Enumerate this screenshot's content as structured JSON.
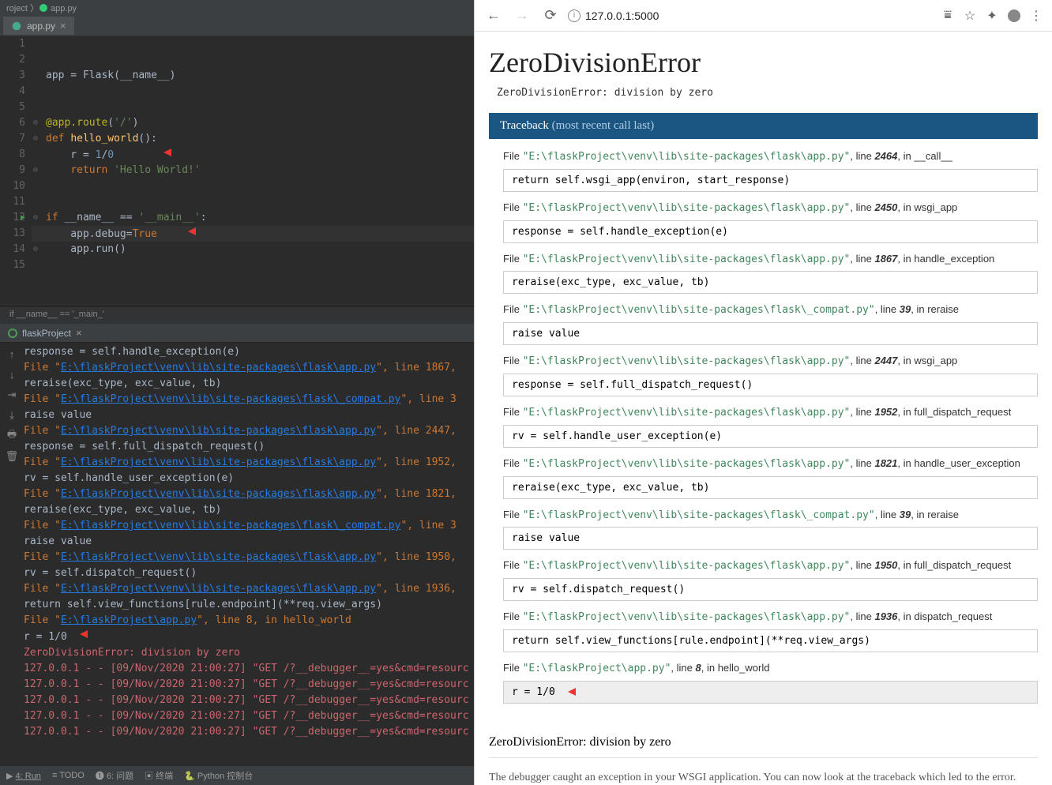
{
  "ide": {
    "project_label": "roject",
    "file_label": "app.py",
    "tab": {
      "label": "app.py"
    },
    "lines": [
      "1",
      "2",
      "3",
      "4",
      "5",
      "6",
      "7",
      "8",
      "9",
      "10",
      "11",
      "12",
      "13",
      "14",
      "15"
    ],
    "code": {
      "l3": "app = Flask(__name__)",
      "l6": "@app.route('/')",
      "l7": "def hello_world():",
      "l8": "    r = 1/0",
      "l9": "    return 'Hello World!'",
      "l12": "if __name__ == '__main__':",
      "l13": "    app.debug=True",
      "l14": "    app.run()"
    },
    "crumb": "if __name__ == '_main_'",
    "console": {
      "tab": "flaskProject",
      "lines": [
        {
          "indent": 2,
          "txt": "response = self.handle_exception(e)",
          "cls": ""
        },
        {
          "indent": 1,
          "file": "E:\\flaskProject\\venv\\lib\\site-packages\\flask\\app.py",
          "after": ", line 1867,"
        },
        {
          "indent": 2,
          "txt": "reraise(exc_type, exc_value, tb)",
          "cls": ""
        },
        {
          "indent": 1,
          "file": "E:\\flaskProject\\venv\\lib\\site-packages\\flask\\_compat.py",
          "after": ", line 3"
        },
        {
          "indent": 2,
          "txt": "raise value",
          "cls": ""
        },
        {
          "indent": 1,
          "file": "E:\\flaskProject\\venv\\lib\\site-packages\\flask\\app.py",
          "after": ", line 2447,"
        },
        {
          "indent": 2,
          "txt": "response = self.full_dispatch_request()",
          "cls": ""
        },
        {
          "indent": 1,
          "file": "E:\\flaskProject\\venv\\lib\\site-packages\\flask\\app.py",
          "after": ", line 1952,"
        },
        {
          "indent": 2,
          "txt": "rv = self.handle_user_exception(e)",
          "cls": ""
        },
        {
          "indent": 1,
          "file": "E:\\flaskProject\\venv\\lib\\site-packages\\flask\\app.py",
          "after": ", line 1821,"
        },
        {
          "indent": 2,
          "txt": "reraise(exc_type, exc_value, tb)",
          "cls": ""
        },
        {
          "indent": 1,
          "file": "E:\\flaskProject\\venv\\lib\\site-packages\\flask\\_compat.py",
          "after": ", line 3"
        },
        {
          "indent": 2,
          "txt": "raise value",
          "cls": ""
        },
        {
          "indent": 1,
          "file": "E:\\flaskProject\\venv\\lib\\site-packages\\flask\\app.py",
          "after": ", line 1950,"
        },
        {
          "indent": 2,
          "txt": "rv = self.dispatch_request()",
          "cls": ""
        },
        {
          "indent": 1,
          "file": "E:\\flaskProject\\venv\\lib\\site-packages\\flask\\app.py",
          "after": ", line 1936,"
        },
        {
          "indent": 2,
          "txt": "return self.view_functions[rule.endpoint](**req.view_args)",
          "cls": ""
        },
        {
          "indent": 1,
          "file": "E:\\flaskProject\\app.py",
          "after": ", line 8, in hello_world"
        },
        {
          "indent": 2,
          "txt": "r = 1/0",
          "cls": "",
          "arrow": true
        },
        {
          "indent": 0,
          "txt": "ZeroDivisionError: division by zero",
          "cls": "cerr"
        },
        {
          "indent": 0,
          "txt": "127.0.0.1 - - [09/Nov/2020 21:00:27] \"GET /?__debugger__=yes&cmd=resourc",
          "cls": "cerr"
        },
        {
          "indent": 0,
          "txt": "127.0.0.1 - - [09/Nov/2020 21:00:27] \"GET /?__debugger__=yes&cmd=resourc",
          "cls": "cerr"
        },
        {
          "indent": 0,
          "txt": "127.0.0.1 - - [09/Nov/2020 21:00:27] \"GET /?__debugger__=yes&cmd=resourc",
          "cls": "cerr"
        },
        {
          "indent": 0,
          "txt": "127.0.0.1 - - [09/Nov/2020 21:00:27] \"GET /?__debugger__=yes&cmd=resourc",
          "cls": "cerr"
        },
        {
          "indent": 0,
          "txt": "127.0.0.1 - - [09/Nov/2020 21:00:27] \"GET /?__debugger__=yes&cmd=resourc",
          "cls": "cerr"
        }
      ]
    },
    "status": {
      "run": "4: Run",
      "todo": "≡ TODO",
      "problems": "❶ 6: 问题",
      "terminal": "▣ 终端",
      "python": "Python 控制台"
    }
  },
  "browser": {
    "url": "127.0.0.1:5000",
    "title": "ZeroDivisionError",
    "exc_msg": "ZeroDivisionError: division by zero",
    "tb_header": "Traceback",
    "tb_sub": "(most recent call last)",
    "frames": [
      {
        "path": "E:\\flaskProject\\venv\\lib\\site-packages\\flask\\app.py",
        "line": "2464",
        "fn": "__call__",
        "code": "return self.wsgi_app(environ, start_response)"
      },
      {
        "path": "E:\\flaskProject\\venv\\lib\\site-packages\\flask\\app.py",
        "line": "2450",
        "fn": "wsgi_app",
        "code": "response = self.handle_exception(e)"
      },
      {
        "path": "E:\\flaskProject\\venv\\lib\\site-packages\\flask\\app.py",
        "line": "1867",
        "fn": "handle_exception",
        "code": "reraise(exc_type, exc_value, tb)"
      },
      {
        "path": "E:\\flaskProject\\venv\\lib\\site-packages\\flask\\_compat.py",
        "line": "39",
        "fn": "reraise",
        "code": "raise value"
      },
      {
        "path": "E:\\flaskProject\\venv\\lib\\site-packages\\flask\\app.py",
        "line": "2447",
        "fn": "wsgi_app",
        "code": "response = self.full_dispatch_request()"
      },
      {
        "path": "E:\\flaskProject\\venv\\lib\\site-packages\\flask\\app.py",
        "line": "1952",
        "fn": "full_dispatch_request",
        "code": "rv = self.handle_user_exception(e)"
      },
      {
        "path": "E:\\flaskProject\\venv\\lib\\site-packages\\flask\\app.py",
        "line": "1821",
        "fn": "handle_user_exception",
        "code": "reraise(exc_type, exc_value, tb)"
      },
      {
        "path": "E:\\flaskProject\\venv\\lib\\site-packages\\flask\\_compat.py",
        "line": "39",
        "fn": "reraise",
        "code": "raise value"
      },
      {
        "path": "E:\\flaskProject\\venv\\lib\\site-packages\\flask\\app.py",
        "line": "1950",
        "fn": "full_dispatch_request",
        "code": "rv = self.dispatch_request()"
      },
      {
        "path": "E:\\flaskProject\\venv\\lib\\site-packages\\flask\\app.py",
        "line": "1936",
        "fn": "dispatch_request",
        "code": "return self.view_functions[rule.endpoint](**req.view_args)"
      },
      {
        "path": "E:\\flaskProject\\app.py",
        "line": "8",
        "fn": "hello_world",
        "code": "r = 1/0",
        "hl": true,
        "arrow": true
      }
    ],
    "bottom_err": "ZeroDivisionError: division by zero",
    "bottom_text": "The debugger caught an exception in your WSGI application. You can now look at the traceback which led to the error."
  }
}
